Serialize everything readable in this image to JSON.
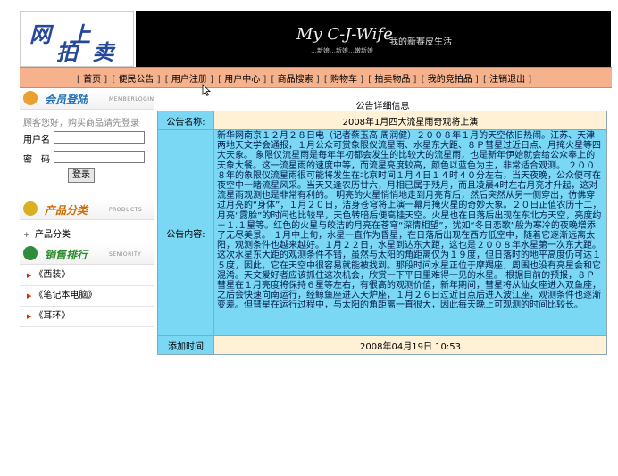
{
  "logo": {
    "line1": "网 上",
    "line2": "拍 卖"
  },
  "banner": {
    "brand": "My C-J-Wife",
    "slogan": "我的新赛皮生活",
    "subslogan": "…新娘…新娘…嫩新娘"
  },
  "nav": {
    "items": [
      "首页",
      "便民公告",
      "用户注册",
      "用户中心",
      "商品搜索",
      "购物车",
      "拍卖物品",
      "我的竞拍品",
      "注销退出"
    ]
  },
  "sidebar": {
    "member": {
      "title": "会员登陆",
      "en": "MEMBERLOGIN",
      "tip": "顾客您好，购买商品请先登录",
      "username_label": "用户名",
      "password_label": "密　码",
      "login_button": "登录"
    },
    "category": {
      "title": "产品分类",
      "en": "PRODUCTS",
      "item": "产品分类"
    },
    "ranking": {
      "title": "销售排行",
      "en": "SENIORITY",
      "items": [
        "《西装》",
        "《笔记本电脑》",
        "《耳环》"
      ]
    }
  },
  "main": {
    "title": "公告详细信息",
    "name_label": "公告名称:",
    "name_value": "2008年1月四大流星雨奇观将上演",
    "content_label": "公告内容:",
    "content_value": "新华网南京１２月２８日电（记者蔡玉高 周润健）２００８年１月的天空依旧热闹。江苏、天津两地天文学会通报，１月公众可赏象限仪流星雨、水星东大距、８Ｐ彗星过近日点、月掩火星等四大天象。 象限仪流星雨是每年年初都会发生的比较大的流星雨，也是新年伊始就会给公众奉上的天象大餐。这一流星雨的速度中等，而流星亮度较高，颜色以蓝色为主，非常适合观测。 ２００８年的象限仪流星雨很可能将发生在北京时间１月４日１４时４０分左右，当天夜晚，公众便可在夜空中一睹流星风采。当天又逢农历廿六，月相已属于残月，而且凌晨4时左右月亮才升起，这对流星雨观测也是非常有利的。 明亮的火星悄悄地走到月亮背后，然后突然从另一侧穿出，仿佛穿过月亮的“身体”，１月２０日，洁身苍穹将上演一幕月掩火星的奇妙天象。２０日正值农历十二，月亮“露脸”的时间也比较早，天色转暗后便高挂天空。火星也在日落后出现在东北方天空，亮度约－１.１星等。红色的火星与皎洁的月亮在苍穹“深情相望”，犹如“冬日恋歌”般为寒冷的夜晚增添了无尽美景。 １月中上旬，水星一直作为昏星，在日落后出现在西方低空中，随着它逐渐远离太阳，观测条件也越来越好。１月２２日，水星到达东大距，这也是２００８年水星第一次东大距。 这次水星东大距的观测条件不错，虽然与太阳的角距离仅为１９度，但日落时的地平高度仍可达１５度，因此，它在天空中很容易就能被找到。那段时间水星正位于摩羯座，周围也没有亮星会和它混淆。天文爱好者应该抓住这次机会，欣赏一下平日里难得一见的水星。 根据目前的预报，８Ｐ彗星在１月亮度将保持６星等左右，有很高的观测价值，新年期间，彗星将从仙女座进入双鱼座，之后会快速向南运行，经鲸鱼座进入天炉座，１月２６日过近日点后进入波江座，观测条件也逐渐变差。但彗星在运行过程中，与太阳的角距离一直很大，因此每天晚上可观测的时间比较长。",
    "time_label": "添加时间",
    "time_value": "2008年04月19日  10:53"
  },
  "colors": {
    "nav_bg": "#f5b28c",
    "label_bg": "#7ad8f4",
    "value_bg": "#fff1d6"
  }
}
